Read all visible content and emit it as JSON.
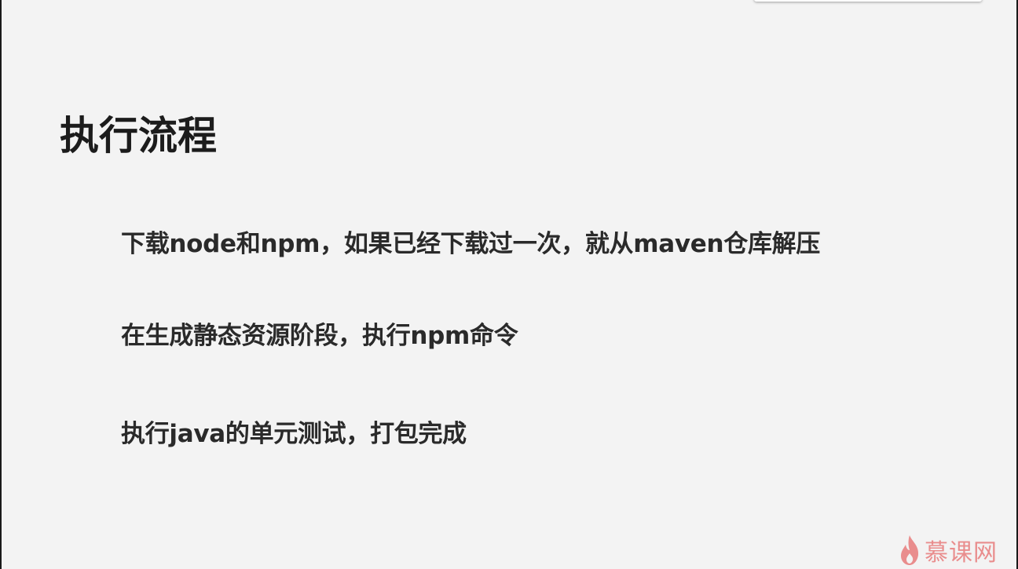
{
  "slide": {
    "title": "执行流程",
    "bullets": [
      "下载node和npm，如果已经下载过一次，就从maven仓库解压",
      "在生成静态资源阶段，执行npm命令",
      "执行java的单元测试，打包完成"
    ]
  },
  "watermark": {
    "text": "慕课网",
    "icon": "flame-icon",
    "color": "#e23a3a"
  }
}
